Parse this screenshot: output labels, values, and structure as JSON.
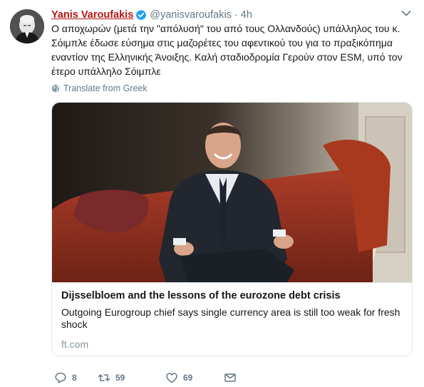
{
  "tweet": {
    "display_name": "Yanis Varoufakis",
    "handle": "@yanisvaroufakis",
    "separator": "·",
    "time": "4h",
    "text_lines": [
      "Ο αποχωρών (μετά την \"απόλυσή\" του από τους Ολλανδούς) υπάλληλος του κ.",
      "Σόιμπλε έδωσε εύσημα στις μαζορέτες του αφεντικού του για το πραξικόπημα",
      "εναντίον της Ελληνικής Άνοιξης. Καλή σταδιοδρομία Γερούν στον ESM, υπό τον",
      "έτερο υπάλληλο Σόιμπλε"
    ],
    "translate_label": "Translate from Greek"
  },
  "card": {
    "title": "Dijsselbloem and the lessons of the eurozone debt crisis",
    "description": "Outgoing Eurogroup chief says single currency area is still too weak for fresh shock",
    "domain": "ft.com"
  },
  "actions": {
    "replies": "8",
    "retweets": "59",
    "likes": "69"
  },
  "icons": [
    "verified-badge-icon",
    "chevron-down-icon",
    "globe-icon",
    "reply-icon",
    "retweet-icon",
    "heart-icon",
    "envelope-icon"
  ],
  "colors": {
    "display_name": "#b41515",
    "muted": "#657786",
    "verified": "#1da1f2",
    "border": "#e1e8ed"
  }
}
